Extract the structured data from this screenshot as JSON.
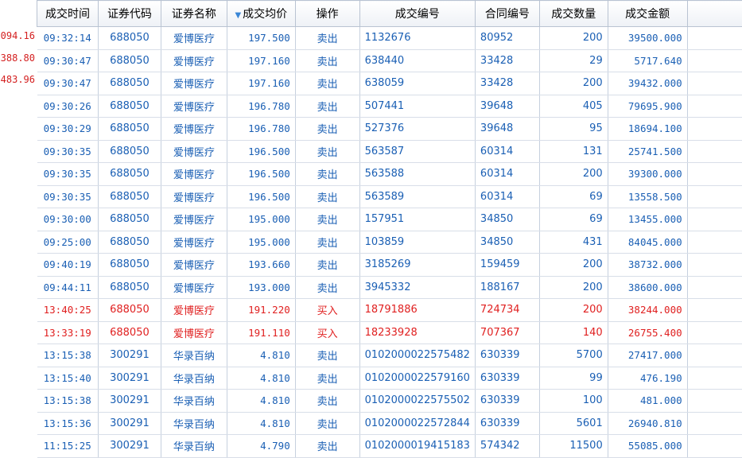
{
  "left_values": [
    "094.16",
    "388.80",
    "483.96"
  ],
  "columns": [
    "成交时间",
    "证券代码",
    "证券名称",
    "成交均价",
    "操作",
    "成交编号",
    "合同编号",
    "成交数量",
    "成交金额"
  ],
  "sorted_column_index": 3,
  "colors": {
    "sell": "#1a5fb4",
    "buy": "#e02020",
    "header_border": "#b9c3d2"
  },
  "rows": [
    {
      "time": "09:32:14",
      "code": "688050",
      "name": "爱博医疗",
      "price": "197.500",
      "op": "卖出",
      "deal_no": "1132676",
      "contract_no": "80952",
      "qty": "200",
      "amount": "39500.000",
      "side": "sell"
    },
    {
      "time": "09:30:47",
      "code": "688050",
      "name": "爱博医疗",
      "price": "197.160",
      "op": "卖出",
      "deal_no": "638440",
      "contract_no": "33428",
      "qty": "29",
      "amount": "5717.640",
      "side": "sell"
    },
    {
      "time": "09:30:47",
      "code": "688050",
      "name": "爱博医疗",
      "price": "197.160",
      "op": "卖出",
      "deal_no": "638059",
      "contract_no": "33428",
      "qty": "200",
      "amount": "39432.000",
      "side": "sell"
    },
    {
      "time": "09:30:26",
      "code": "688050",
      "name": "爱博医疗",
      "price": "196.780",
      "op": "卖出",
      "deal_no": "507441",
      "contract_no": "39648",
      "qty": "405",
      "amount": "79695.900",
      "side": "sell"
    },
    {
      "time": "09:30:29",
      "code": "688050",
      "name": "爱博医疗",
      "price": "196.780",
      "op": "卖出",
      "deal_no": "527376",
      "contract_no": "39648",
      "qty": "95",
      "amount": "18694.100",
      "side": "sell"
    },
    {
      "time": "09:30:35",
      "code": "688050",
      "name": "爱博医疗",
      "price": "196.500",
      "op": "卖出",
      "deal_no": "563587",
      "contract_no": "60314",
      "qty": "131",
      "amount": "25741.500",
      "side": "sell"
    },
    {
      "time": "09:30:35",
      "code": "688050",
      "name": "爱博医疗",
      "price": "196.500",
      "op": "卖出",
      "deal_no": "563588",
      "contract_no": "60314",
      "qty": "200",
      "amount": "39300.000",
      "side": "sell"
    },
    {
      "time": "09:30:35",
      "code": "688050",
      "name": "爱博医疗",
      "price": "196.500",
      "op": "卖出",
      "deal_no": "563589",
      "contract_no": "60314",
      "qty": "69",
      "amount": "13558.500",
      "side": "sell"
    },
    {
      "time": "09:30:00",
      "code": "688050",
      "name": "爱博医疗",
      "price": "195.000",
      "op": "卖出",
      "deal_no": "157951",
      "contract_no": "34850",
      "qty": "69",
      "amount": "13455.000",
      "side": "sell"
    },
    {
      "time": "09:25:00",
      "code": "688050",
      "name": "爱博医疗",
      "price": "195.000",
      "op": "卖出",
      "deal_no": "103859",
      "contract_no": "34850",
      "qty": "431",
      "amount": "84045.000",
      "side": "sell"
    },
    {
      "time": "09:40:19",
      "code": "688050",
      "name": "爱博医疗",
      "price": "193.660",
      "op": "卖出",
      "deal_no": "3185269",
      "contract_no": "159459",
      "qty": "200",
      "amount": "38732.000",
      "side": "sell"
    },
    {
      "time": "09:44:11",
      "code": "688050",
      "name": "爱博医疗",
      "price": "193.000",
      "op": "卖出",
      "deal_no": "3945332",
      "contract_no": "188167",
      "qty": "200",
      "amount": "38600.000",
      "side": "sell"
    },
    {
      "time": "13:40:25",
      "code": "688050",
      "name": "爱博医疗",
      "price": "191.220",
      "op": "买入",
      "deal_no": "18791886",
      "contract_no": "724734",
      "qty": "200",
      "amount": "38244.000",
      "side": "buy"
    },
    {
      "time": "13:33:19",
      "code": "688050",
      "name": "爱博医疗",
      "price": "191.110",
      "op": "买入",
      "deal_no": "18233928",
      "contract_no": "707367",
      "qty": "140",
      "amount": "26755.400",
      "side": "buy"
    },
    {
      "time": "13:15:38",
      "code": "300291",
      "name": "华录百纳",
      "price": "4.810",
      "op": "卖出",
      "deal_no": "0102000022575482",
      "contract_no": "630339",
      "qty": "5700",
      "amount": "27417.000",
      "side": "sell"
    },
    {
      "time": "13:15:40",
      "code": "300291",
      "name": "华录百纳",
      "price": "4.810",
      "op": "卖出",
      "deal_no": "0102000022579160",
      "contract_no": "630339",
      "qty": "99",
      "amount": "476.190",
      "side": "sell"
    },
    {
      "time": "13:15:38",
      "code": "300291",
      "name": "华录百纳",
      "price": "4.810",
      "op": "卖出",
      "deal_no": "0102000022575502",
      "contract_no": "630339",
      "qty": "100",
      "amount": "481.000",
      "side": "sell"
    },
    {
      "time": "13:15:36",
      "code": "300291",
      "name": "华录百纳",
      "price": "4.810",
      "op": "卖出",
      "deal_no": "0102000022572844",
      "contract_no": "630339",
      "qty": "5601",
      "amount": "26940.810",
      "side": "sell"
    },
    {
      "time": "11:15:25",
      "code": "300291",
      "name": "华录百纳",
      "price": "4.790",
      "op": "卖出",
      "deal_no": "0102000019415183",
      "contract_no": "574342",
      "qty": "11500",
      "amount": "55085.000",
      "side": "sell"
    }
  ]
}
